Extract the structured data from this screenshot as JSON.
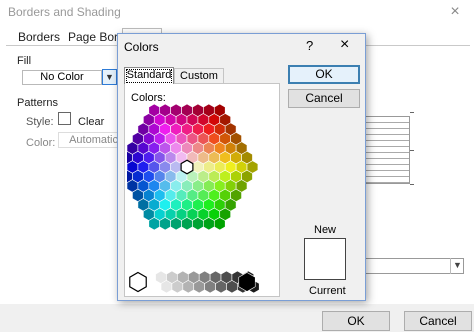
{
  "background_dialog": {
    "title": "Borders and Shading",
    "close_glyph": "×",
    "tabs": [
      {
        "label": "Borders"
      },
      {
        "label": "Page Border"
      },
      {
        "label": ""
      }
    ],
    "fill": {
      "label": "Fill",
      "value": "No Color",
      "dropdown_icon": "chevron-down-icon"
    },
    "patterns": {
      "label": "Patterns",
      "style_label": "Style:",
      "style_value": "Clear",
      "color_label": "Color:",
      "color_value": "Automatic"
    },
    "buttons": {
      "ok": "OK",
      "cancel": "Cancel"
    }
  },
  "colors_dialog": {
    "title": "Colors",
    "help_glyph": "?",
    "close_glyph": "×",
    "tabs": [
      {
        "label": "Standard",
        "selected": true
      },
      {
        "label": "Custom",
        "selected": false
      }
    ],
    "colors_label": "Colors:",
    "buttons": {
      "ok": "OK",
      "cancel": "Cancel"
    },
    "new_label": "New",
    "current_label": "Current",
    "new_color": "#ffffff",
    "selected_color": "#ffffff",
    "grayscale_row": [
      "#ffffff",
      "#e6e6e6",
      "#cccccc",
      "#b3b3b3",
      "#999999",
      "#808080",
      "#666666",
      "#4d4d4d",
      "#333333",
      "#1a1a1a",
      "#000000"
    ]
  }
}
